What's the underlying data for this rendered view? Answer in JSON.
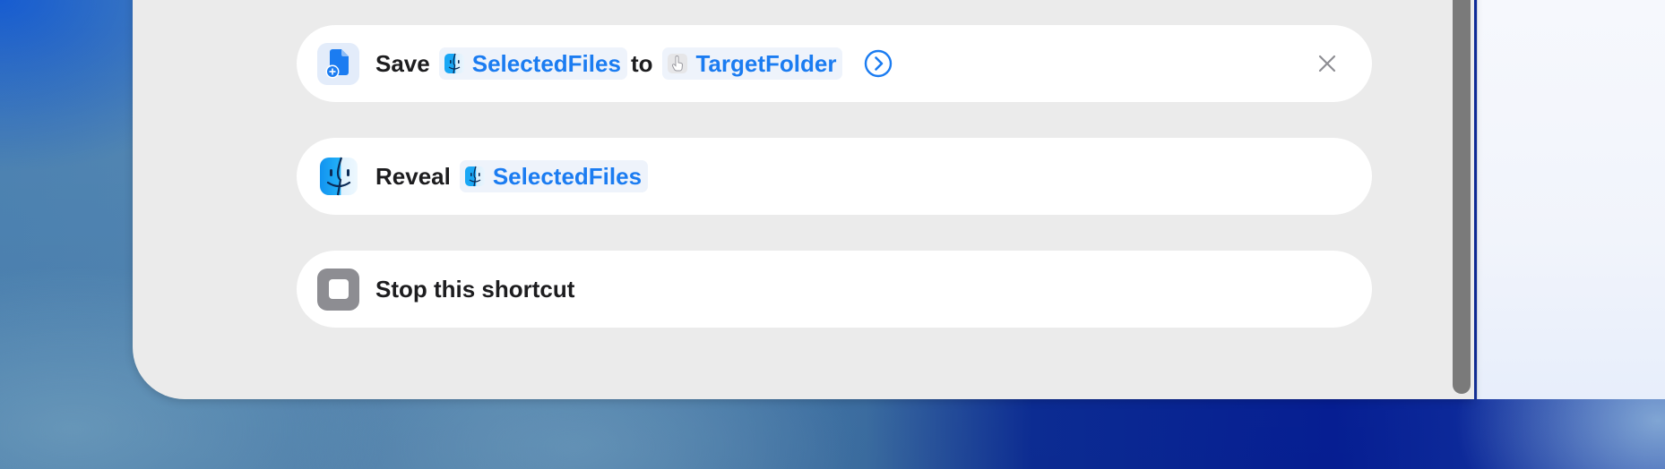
{
  "actions": [
    {
      "verb": "Save",
      "icon": "document-save-icon",
      "variables": [
        {
          "label": "SelectedFiles",
          "icon": "finder-icon"
        },
        {
          "label": "TargetFolder",
          "icon": "hand-pointer-icon"
        }
      ],
      "connector": "to",
      "controls": [
        "chevron-circle-right-icon",
        "close-icon"
      ]
    },
    {
      "verb": "Reveal",
      "icon": "finder-icon",
      "variables": [
        {
          "label": "SelectedFiles",
          "icon": "finder-icon"
        }
      ]
    },
    {
      "verb": "Stop this shortcut",
      "icon": "stop-icon"
    }
  ],
  "colors": {
    "accent": "#1b7cf1",
    "panel": "#ebebeb",
    "card": "#ffffff",
    "text": "#1d1d1f",
    "token_bg": "#eef3fb"
  }
}
